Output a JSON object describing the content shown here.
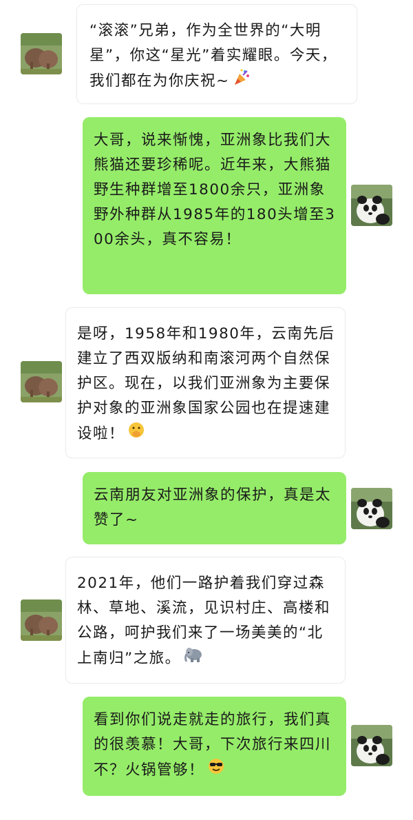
{
  "conversation": {
    "messages": [
      {
        "sender": "elephant",
        "side": "left",
        "text": "“滚滚”兄弟，作为全世界的“大明星”，你这“星光”着实耀眼。今天，我们都在为你庆祝~",
        "emoji": "party-popper"
      },
      {
        "sender": "panda",
        "side": "right",
        "text": "大哥，说来惭愧，亚洲象比我们大熊猫还要珍稀呢。近年来，大熊猫野生种群增至1800余只，亚洲象野外种群从1985年的180头增至300余头，真不容易！",
        "emoji": ""
      },
      {
        "sender": "elephant",
        "side": "left",
        "text": "是呀，1958年和1980年，云南先后建立了西双版纳和南滚河两个自然保护区。现在，以我们亚洲象为主要保护对象的亚洲象国家公园也在提速建设啦！",
        "emoji": "shushing-face"
      },
      {
        "sender": "panda",
        "side": "right",
        "text": "云南朋友对亚洲象的保护，真是太赞了~",
        "emoji": ""
      },
      {
        "sender": "elephant",
        "side": "left",
        "text": "2021年，他们一路护着我们穿过森林、草地、溪流，见识村庄、高楼和公路，呵护我们来了一场美美的“北上南归”之旅。",
        "emoji": "elephant"
      },
      {
        "sender": "panda",
        "side": "right",
        "text": "看到你们说走就走的旅行，我们真的很羡慕！大哥，下次旅行来四川不？火锅管够！",
        "emoji": "sunglasses-face"
      }
    ]
  },
  "colors": {
    "left_bubble": "#ffffff",
    "right_bubble": "#95ec69"
  }
}
